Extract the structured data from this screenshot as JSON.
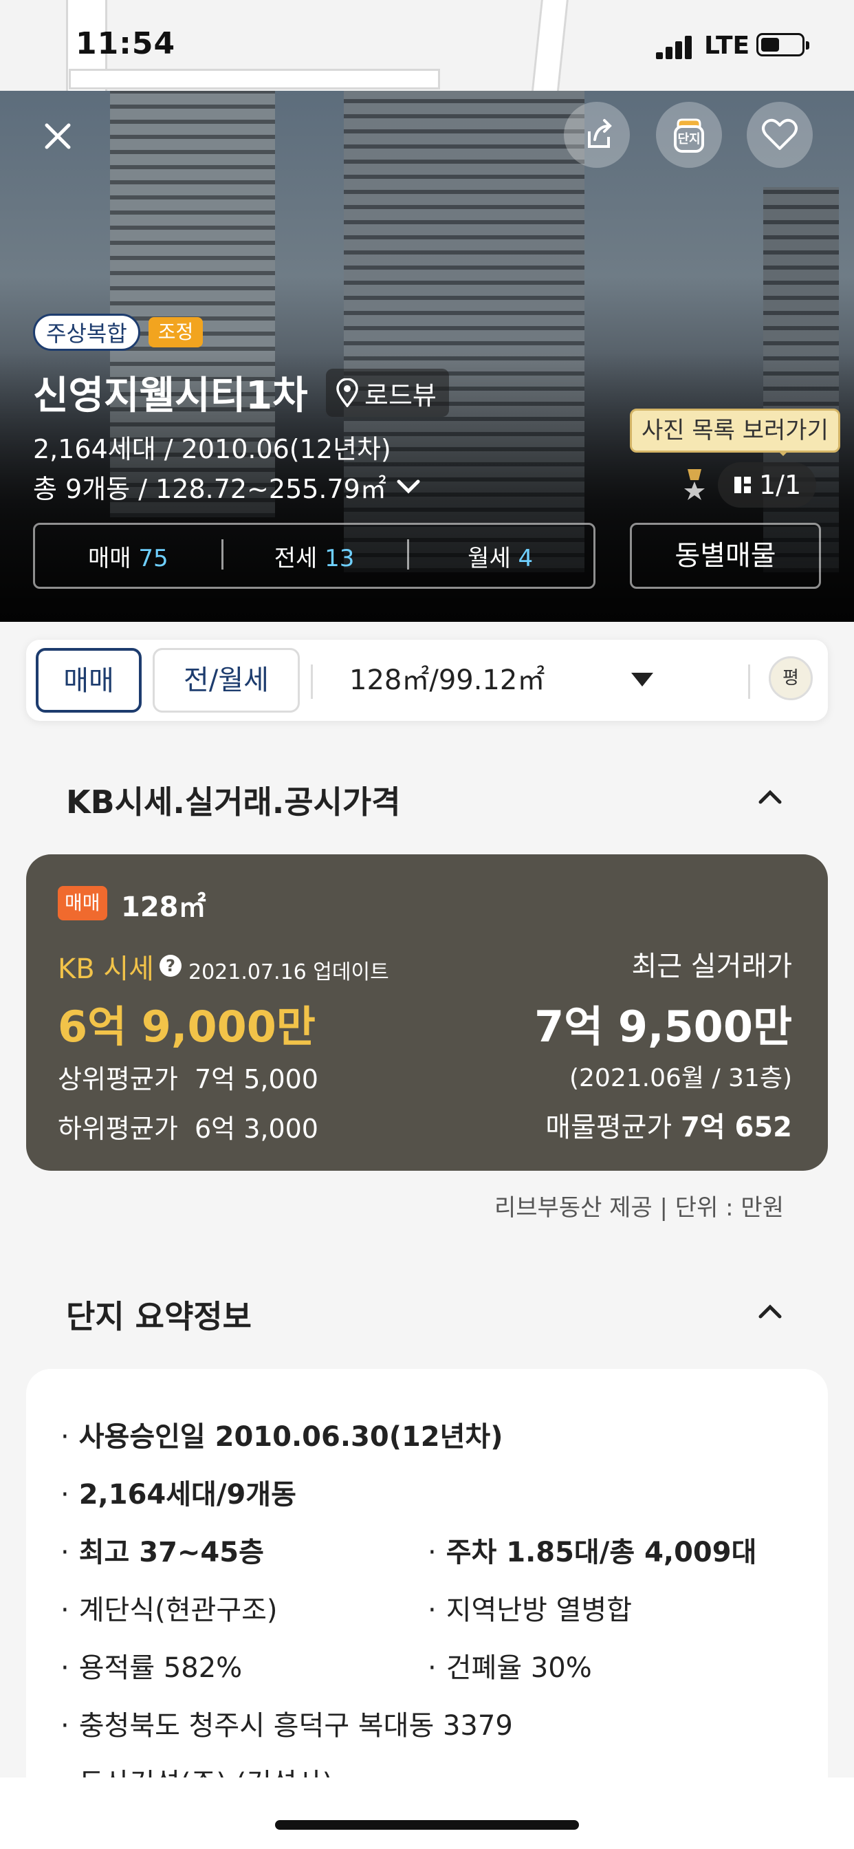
{
  "status_bar": {
    "time": "11:54",
    "network": "LTE"
  },
  "hero": {
    "tags": {
      "type": "주상복합",
      "status": "조정"
    },
    "title": "신영지웰시티1차",
    "roadview_label": "로드뷰",
    "households_year": "2,164세대 / 2010.06(12년차)",
    "buildings_area": "총 9개동 / 128.72~255.79㎡",
    "photo_tooltip": "사진 목록 보러가기",
    "photo_count": "1/1",
    "deals": [
      {
        "label": "매매",
        "count": "75"
      },
      {
        "label": "전세",
        "count": "13"
      },
      {
        "label": "월세",
        "count": "4"
      }
    ],
    "dong_button": "동별매물",
    "icons": {
      "close": "close-icon",
      "share": "share-icon",
      "danji": "honey-jar-icon",
      "favorite": "heart-icon",
      "danji_label": "단지"
    }
  },
  "selector": {
    "tab_sale": "매매",
    "tab_rent": "전/월세",
    "area": "128㎡/99.12㎡",
    "unit_toggle": "평"
  },
  "kb_section": {
    "title": "KB시세.실거래.공시가격",
    "card": {
      "badge": "매매",
      "area": "128㎡",
      "kb_label": "KB 시세",
      "help": "?",
      "updated": "2021.07.16 업데이트",
      "kb_price": "6억 9,000만",
      "upper_label": "상위평균가",
      "upper_value": "7억 5,000",
      "lower_label": "하위평균가",
      "lower_value": "6억 3,000",
      "recent_label": "최근 실거래가",
      "recent_price": "7억 9,500만",
      "recent_sub": "(2021.06월 / 31층)",
      "listing_avg_label": "매물평균가",
      "listing_avg_value": "7억 652"
    },
    "provider": "리브부동산 제공 | 단위 : 만원"
  },
  "summary_section": {
    "title": "단지 요약정보",
    "items": {
      "approval": "사용승인일 2010.06.30(12년차)",
      "households": "2,164세대/9개동",
      "floors": "최고 37~45층",
      "parking": "주차 1.85대/총 4,009대",
      "hall": "계단식(현관구조)",
      "heating": "지역난방 열병합",
      "far": "용적률 582%",
      "bcr": "건폐율 30%",
      "address": "충청북도 청주시 흥덕구 복대동 3379",
      "builder": "두산건설(주) (건설사)"
    },
    "bullet": "·"
  },
  "colors": {
    "navy": "#1d3c6e",
    "kb_card": "#55524a",
    "kb_yellow": "#f2c349",
    "deal_count": "#6fd0ff",
    "badge_orange": "#f06a2e",
    "adj_tag": "#f2a41f"
  }
}
